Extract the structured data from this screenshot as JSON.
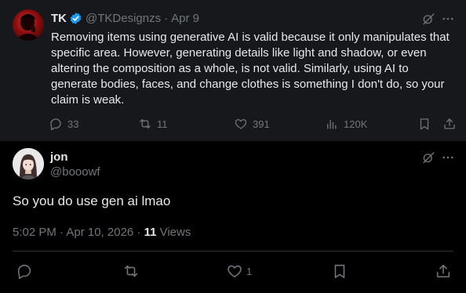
{
  "parent_tweet": {
    "author_name": "TK",
    "handle": "@TKDesignzs",
    "separator": "·",
    "date": "Apr 9",
    "body": "Removing items using generative AI is valid because it only manipulates that specific area. However, generating details like light and shadow, or even altering the composition as a whole, is not valid. Similarly, using AI to generate bodies, faces, and change clothes is something I don't do, so your claim is weak.",
    "replies": "33",
    "reposts": "11",
    "likes": "391",
    "views": "120K",
    "icons": {
      "verified": "verified-badge-icon",
      "grok": "grok-icon",
      "more": "more-icon",
      "reply": "reply-icon",
      "repost": "repost-icon",
      "like": "like-icon",
      "views": "views-icon",
      "bookmark": "bookmark-icon",
      "share": "share-icon"
    }
  },
  "reply_tweet": {
    "author_name": "jon",
    "handle": "@booowf",
    "body": "So you do use gen ai lmao",
    "time": "5:02 PM · Apr 10, 2026 · ",
    "views_count": "11",
    "views_label": " Views",
    "likes": "1"
  },
  "colors": {
    "background": "#000000",
    "parent_background": "#16181c",
    "text": "#e7e9ea",
    "muted": "#71767b",
    "divider": "#2f3336",
    "verified_blue": "#1d9bf0"
  }
}
